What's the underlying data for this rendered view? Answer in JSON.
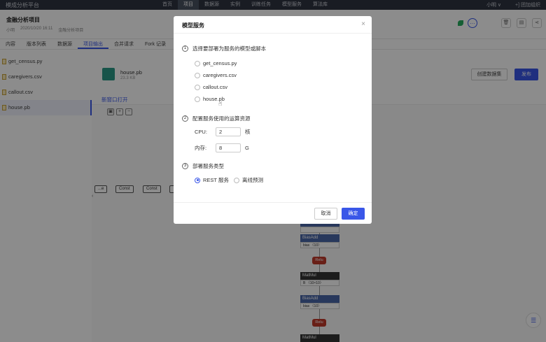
{
  "topnav": {
    "brand": "模成分析平台",
    "items": [
      "首页",
      "项目",
      "数据源",
      "实例",
      "训练任务",
      "模型服务",
      "算法库"
    ],
    "active_index": 1,
    "user": "小明 ∨",
    "join_org": "+] 团加组织"
  },
  "project": {
    "title": "金融分析项目",
    "owner": "小明",
    "date": "2020/10/20 16:11",
    "desc": "金融分析项目",
    "more_icon": "…"
  },
  "tabs": {
    "items": [
      "内容",
      "版本列表",
      "数据源",
      "项目输出",
      "合并请求",
      "Fork 记录"
    ],
    "active_index": 3
  },
  "files": [
    "get_census.py",
    "caregivers.csv",
    "callout.csv",
    "house.pb"
  ],
  "active_file_index": 3,
  "main": {
    "file_name": "house.pb",
    "file_size": "23.3 KB",
    "create_label": "创建数据集",
    "publish_label": "发布",
    "open_new_window": "新窗口打开",
    "zoom_buttons": [
      "▣",
      "+",
      "−"
    ]
  },
  "graph": {
    "const_nodes": [
      "...e",
      "Const",
      "Const",
      ""
    ],
    "nodes": [
      {
        "title": "",
        "body": ""
      },
      {
        "title": "BiasAdd",
        "body": "bias 〈10〉"
      },
      {
        "title": "MatMul",
        "body": "B 〈10×10〉"
      },
      {
        "title": "BiasAdd",
        "body": "bias 〈10〉"
      },
      {
        "title": "MatMul",
        "body": ""
      }
    ],
    "relu_label": "Relu"
  },
  "modal": {
    "title": "模型服务",
    "close": "×",
    "step1": {
      "num": "1",
      "label": "选择要部署为服务的模型或脚本"
    },
    "options": [
      "get_census.py",
      "caregivers.csv",
      "callout.csv",
      "house.pb"
    ],
    "step2": {
      "num": "2",
      "label": "配置服务使用的运算资源"
    },
    "cpu": {
      "label": "CPU:",
      "value": "2",
      "unit": "核"
    },
    "mem": {
      "label": "内存:",
      "value": "8",
      "unit": "G"
    },
    "step3": {
      "num": "3",
      "label": "部署服务类型"
    },
    "types": [
      "REST 服务",
      "离线预测"
    ],
    "selected_type_index": 0,
    "cancel_label": "取消",
    "ok_label": "确定"
  },
  "colors": {
    "accent": "#3a57e8",
    "nav_bg": "#2f3440",
    "relu": "#c0392b"
  }
}
